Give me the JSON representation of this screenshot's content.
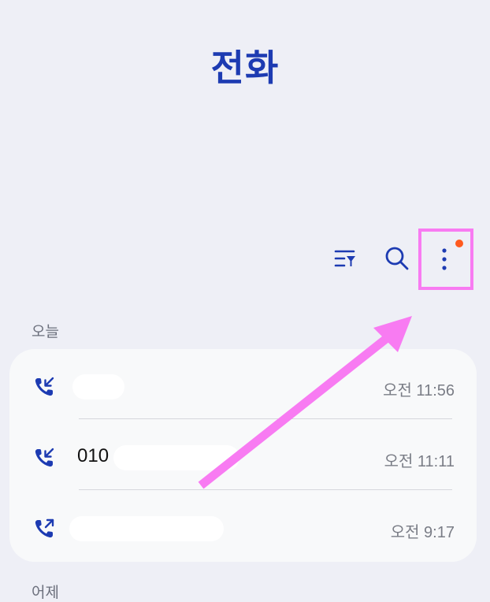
{
  "header": {
    "title": "전화"
  },
  "toolbar": {
    "filter_icon": "filter-list-icon",
    "search_icon": "search-icon",
    "more_icon": "more-vertical-icon",
    "notification_dot_color": "#ff5a1f",
    "accent_color": "#1d3bb2"
  },
  "sections": {
    "today": "오늘",
    "yesterday": "어제"
  },
  "calls": [
    {
      "type": "incoming",
      "icon": "incoming-call-icon",
      "name": "",
      "time": "오전 11:56"
    },
    {
      "type": "incoming",
      "icon": "incoming-call-icon",
      "name": "010",
      "time": "오전 11:11"
    },
    {
      "type": "outgoing",
      "icon": "outgoing-call-icon",
      "name": "",
      "time": "오전 9:17"
    }
  ],
  "annotation": {
    "color": "#f87bf2"
  }
}
